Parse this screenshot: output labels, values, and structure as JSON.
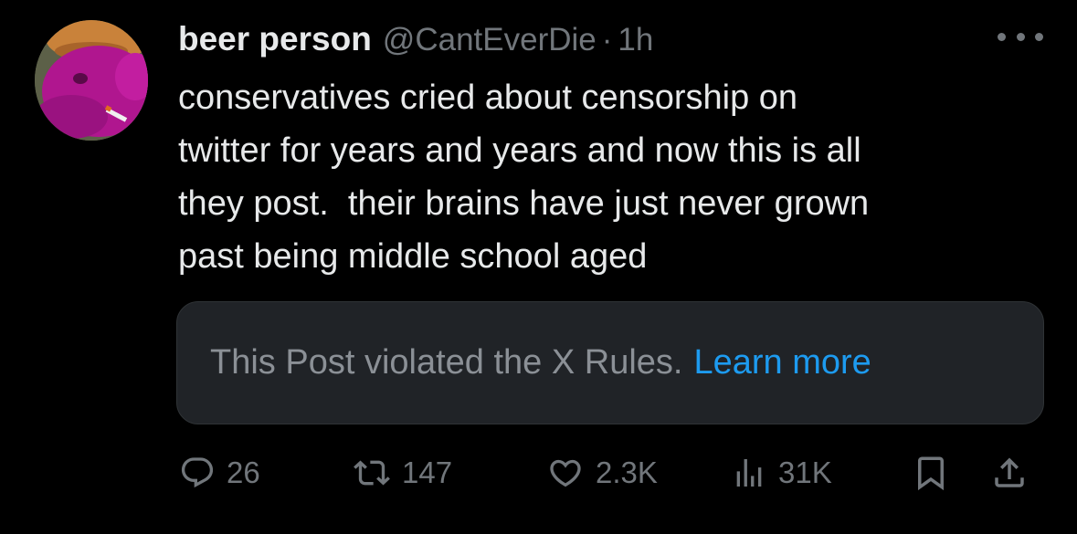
{
  "author": {
    "display_name": "beer person",
    "handle": "@CantEverDie",
    "separator": "·",
    "time": "1h"
  },
  "tweet": {
    "text": "conservatives cried about censorship on\ntwitter for years and years and now this is all\nthey post.  their brains have just never grown\npast being middle school aged"
  },
  "notice": {
    "text": "This Post violated the X Rules.",
    "link_label": "Learn more"
  },
  "actions": {
    "replies": "26",
    "reposts": "147",
    "likes": "2.3K",
    "views": "31K"
  },
  "icons": {
    "more": "more-options-icon",
    "reply": "reply-icon",
    "repost": "repost-icon",
    "like": "heart-icon",
    "views": "views-chart-icon",
    "bookmark": "bookmark-icon",
    "share": "share-icon"
  },
  "colors": {
    "background": "#000000",
    "text": "#e7e9ea",
    "muted": "#71767b",
    "link": "#1d9bf0",
    "notice_bg": "#202327"
  }
}
